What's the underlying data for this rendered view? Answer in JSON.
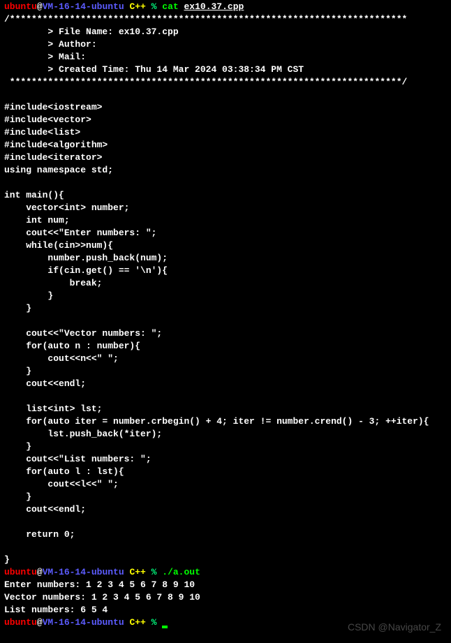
{
  "prompt1": {
    "user": "ubuntu",
    "at": "@",
    "host": "VM-16-14-ubuntu",
    "dir": " C++",
    "pct": " % ",
    "cmd": "cat ",
    "arg": "ex10.37.cpp"
  },
  "header": {
    "top": "/*************************************************************************",
    "f1": "        > File Name: ex10.37.cpp",
    "f2": "        > Author:",
    "f3": "        > Mail:",
    "f4": "        > Created Time: Thu 14 Mar 2024 03:38:34 PM CST",
    "bot": " ************************************************************************/"
  },
  "code": {
    "inc1": "#include<iostream>",
    "inc2": "#include<vector>",
    "inc3": "#include<list>",
    "inc4": "#include<algorithm>",
    "inc5": "#include<iterator>",
    "using": "using namespace std;",
    "main": "int main(){",
    "l1": "    vector<int> number;",
    "l2": "    int num;",
    "l3": "    cout<<\"Enter numbers: \";",
    "l4": "    while(cin>>num){",
    "l5": "        number.push_back(num);",
    "l6": "        if(cin.get() == '\\n'){",
    "l7": "            break;",
    "l8": "        }",
    "l9": "    }",
    "l10": "    cout<<\"Vector numbers: \";",
    "l11": "    for(auto n : number){",
    "l12": "        cout<<n<<\" \";",
    "l13": "    }",
    "l14": "    cout<<endl;",
    "l15": "    list<int> lst;",
    "l16": "    for(auto iter = number.crbegin() + 4; iter != number.crend() - 3; ++iter){",
    "l17": "        lst.push_back(*iter);",
    "l18": "    }",
    "l19": "    cout<<\"List numbers: \";",
    "l20": "    for(auto l : lst){",
    "l21": "        cout<<l<<\" \";",
    "l22": "    }",
    "l23": "    cout<<endl;",
    "l24": "    return 0;",
    "l25": "}"
  },
  "prompt2": {
    "user": "ubuntu",
    "at": "@",
    "host": "VM-16-14-ubuntu",
    "dir": " C++",
    "pct": " % ",
    "cmd": "./a.out"
  },
  "output": {
    "o1": "Enter numbers: 1 2 3 4 5 6 7 8 9 10",
    "o2": "Vector numbers: 1 2 3 4 5 6 7 8 9 10",
    "o3": "List numbers: 6 5 4"
  },
  "prompt3": {
    "user": "ubuntu",
    "at": "@",
    "host": "VM-16-14-ubuntu",
    "dir": " C++",
    "pct": " % "
  },
  "watermark": "CSDN @Navigator_Z"
}
